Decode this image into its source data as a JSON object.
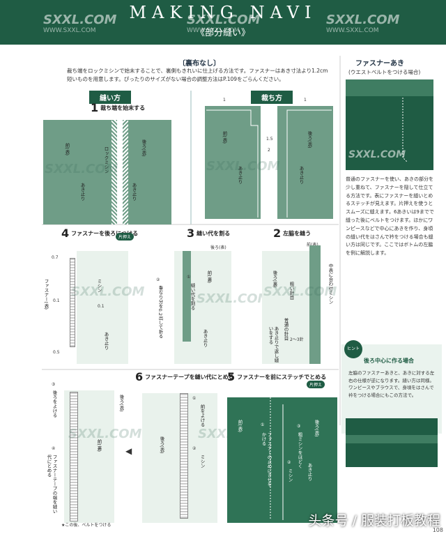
{
  "header": {
    "title": "MAKING NAVI",
    "subtitle": "《部分縫い》",
    "watermark": "SXXL.COM",
    "watermark_url": "WWW.SXXL.COM"
  },
  "section_left": {
    "heading": "〔裏布なし〕",
    "intro": "裁ち端をロックミシンで始末することで、裏側もきれいに仕上げる方法です。ファスナーはあき寸法より1.2cm短いものを用意します。ぴったりのサイズがない場合の調整方法はP.109をごらんください。",
    "tag_sewing": "縫い方",
    "tag_cutting": "裁ち方"
  },
  "section_right": {
    "heading": "ファスナーあき",
    "subheading": "(ウエストベルトをつける場合)",
    "body": "普通のファスナーを使い、あきの部分を少し重ねて、ファスナーを隠して仕立てる方法です。表にファスナーを縫いとめるステッチが見えます。片押えを使うとスムーズに縫えます。6あきいは9までで縫った後にベルトをつけます。ほかにワンピースなどで中心にあきを作り、身頃の縫い代をはさんで衿をつける場合も縫い方は同じです。ここではボトムの左脇を例に解説します。",
    "hint_label": "ヒント",
    "hint_title": "後ろ中心に作る場合",
    "hint_body": "左脇のファスナーあきと、あきに対する左右の仕様が逆になります。縫い方は同様。ワンピースやブラウスで、身頃をはさんで衿をつける場合にもこの方法で。"
  },
  "steps": {
    "s1": {
      "num": "1",
      "text": "裁ち端を始末する",
      "lock": "ロックミシン",
      "front": "前(表)",
      "back": "後ろ(表)",
      "open": "あき止り"
    },
    "cut": {
      "front": "前(表)",
      "back": "後ろ(表)",
      "open": "あき止り",
      "m1": "1",
      "m2": "1.5",
      "m3": "1",
      "m4": "2"
    },
    "s2": {
      "num": "2",
      "text": "左脇を縫う",
      "front": "前(表)",
      "back": "後ろ(裏)",
      "coarse": "粗い針目",
      "normal": "普通の針目",
      "center": "中表に合わせミシン",
      "note": "あき止りで返し縫いをする",
      "stitch": "2〜3針"
    },
    "s3": {
      "num": "3",
      "text": "縫い代を割る",
      "back_label": "後ろ(表)",
      "mark1": "①",
      "txt1": "縫い代を割る",
      "mark2": "②",
      "txt2": "重なり分を0.2出して折る",
      "front": "前(裏)",
      "open": "あき止り"
    },
    "s4": {
      "num": "4",
      "text": "ファスナーを後ろにつける",
      "pill": "片押え",
      "v07": "0.7",
      "v01a": "0.1",
      "v01b": "0.1",
      "v05": "0.5",
      "zip": "ファスナー(表)",
      "sew": "ミシン",
      "open": "あき止り"
    },
    "s5": {
      "num": "5",
      "text": "ファスナーを前にステッチでとめる",
      "pill": "片押え",
      "front": "前(表)",
      "back": "後ろ(表)",
      "m1": "①",
      "t1": "ファスナーの止めにきせをかける",
      "m2": "②",
      "t2": "ミシン",
      "m3": "③",
      "t3": "粗ミシンをほどく",
      "open": "あき止り"
    },
    "s6": {
      "num": "6",
      "text": "ファスナーテープを縫い代にとめる",
      "front": "前",
      "back": "後ろ(表)",
      "front2": "前(裏)",
      "m1": "①",
      "t1": "前をよける",
      "m2": "②",
      "t2": "ミシン"
    },
    "s7": {
      "m3": "③",
      "t3": "後ろをよける",
      "m4": "④",
      "t4": "ファスナーテープの端を縫い代にとめる",
      "back": "後ろ(表)",
      "front": "前(裏)",
      "note": "★この後、ベルトをつける"
    }
  },
  "footer": {
    "text": "头条号 / 服装打板教程",
    "page": "108"
  }
}
